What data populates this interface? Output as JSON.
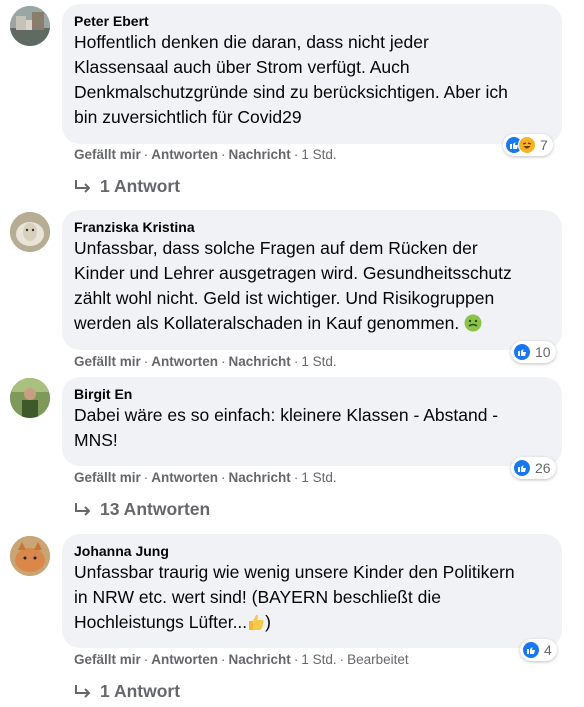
{
  "comments": [
    {
      "author": "Peter Ebert",
      "text": "Hoffentlich denken die daran, dass nicht jeder\nKlassensaal auch über Strom verfügt. Auch\nDenkmalschutzgründe sind zu berücksichtigen. Aber ich\nbin zuversichtlich für Covid29",
      "like_label": "Gefällt mir",
      "reply_label": "Antworten",
      "message_label": "Nachricht",
      "time": "1 Std.",
      "reaction_count": "7",
      "replies_label": "1 Antwort"
    },
    {
      "author": "Franziska Kristina",
      "text": "Unfassbar, dass solche Fragen auf dem Rücken der\nKinder und Lehrer ausgetragen wird. Gesundheitsschutz\nzählt wohl nicht. Geld ist wichtiger. Und Risikogruppen\nwerden als Kollateralschaden in Kauf genommen.",
      "like_label": "Gefällt mir",
      "reply_label": "Antworten",
      "message_label": "Nachricht",
      "time": "1 Std.",
      "reaction_count": "10"
    },
    {
      "author": "Birgit En",
      "text": "Dabei wäre es so einfach: kleinere Klassen - Abstand -\nMNS!",
      "like_label": "Gefällt mir",
      "reply_label": "Antworten",
      "message_label": "Nachricht",
      "time": "1 Std.",
      "reaction_count": "26",
      "replies_label": "13 Antworten"
    },
    {
      "author": "Johanna Jung",
      "text": "Unfassbar traurig wie wenig unsere Kinder den Politikern\nin NRW etc. wert sind! (BAYERN beschließt die\nHochleistungs Lüfter...",
      "text_end": ")",
      "like_label": "Gefällt mir",
      "reply_label": "Antworten",
      "message_label": "Nachricht",
      "time": "1 Std.",
      "edited_label": "Bearbeitet",
      "reaction_count": "4",
      "replies_label": "1 Antwort"
    }
  ],
  "icons": {
    "like": "like-icon",
    "haha": "haha-icon",
    "reply_arrow": "reply-arrow-icon",
    "sick_emoji": "nauseated-face-emoji",
    "thumbs_emoji": "thumbs-up-emoji"
  },
  "colors": {
    "bubble": "#f0f2f5",
    "meta_text": "#65676b",
    "like_blue": "#1877f2",
    "haha_yellow": "#f7b125"
  }
}
